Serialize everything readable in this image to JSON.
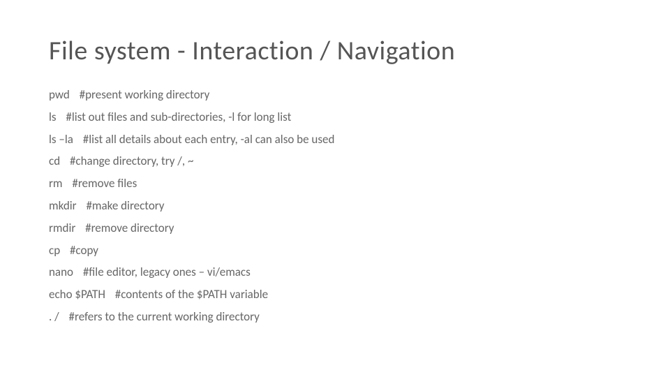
{
  "title": "File system - Interaction / Navigation",
  "commands": [
    {
      "cmd": "pwd",
      "comment": "#present working directory"
    },
    {
      "cmd": "ls",
      "comment": "#list out files and sub-directories, -l for long list"
    },
    {
      "cmd": "ls –la",
      "comment": "#list all details about each entry, -al can also be used"
    },
    {
      "cmd": "cd",
      "comment": "#change directory, try /, ~"
    },
    {
      "cmd": "rm",
      "comment": "#remove files"
    },
    {
      "cmd": "mkdir",
      "comment": "#make directory"
    },
    {
      "cmd": "rmdir",
      "comment": "#remove directory"
    },
    {
      "cmd": "cp",
      "comment": "#copy"
    },
    {
      "cmd": "nano",
      "comment": "#file editor, legacy ones – vi/emacs"
    },
    {
      "cmd": "echo $PATH",
      "comment": "#contents of the $PATH variable"
    },
    {
      "cmd": ". /",
      "comment": "#refers to the current working directory"
    }
  ]
}
